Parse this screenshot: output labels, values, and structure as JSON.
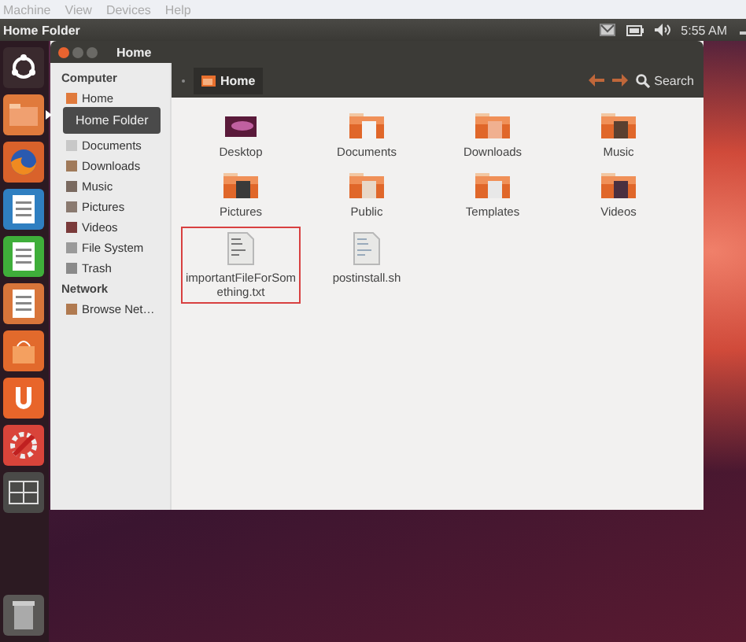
{
  "menubar": [
    {
      "label": "Machine"
    },
    {
      "label": "View"
    },
    {
      "label": "Devices"
    },
    {
      "label": "Help"
    }
  ],
  "top_panel": {
    "title": "Home Folder",
    "clock": "5:55 AM"
  },
  "launcher": {
    "items": [
      {
        "kind": "ubuntu",
        "running": false
      },
      {
        "kind": "home",
        "running": true,
        "tooltip": "Home Folder"
      },
      {
        "kind": "firefox",
        "running": false
      },
      {
        "kind": "writer",
        "running": false
      },
      {
        "kind": "calc",
        "running": false
      },
      {
        "kind": "impress",
        "running": false
      },
      {
        "kind": "software",
        "running": false
      },
      {
        "kind": "ubuntuone",
        "running": false
      },
      {
        "kind": "settings",
        "running": false
      },
      {
        "kind": "workspaces",
        "running": false
      },
      {
        "kind": "trash",
        "running": false
      }
    ]
  },
  "window": {
    "title": "Home",
    "location": "Home",
    "search": "Search",
    "sidebar": [
      {
        "heading": "Computer",
        "items": [
          {
            "label": "Home",
            "kind": "home"
          },
          {
            "label": "Documents",
            "kind": "documents"
          },
          {
            "label": "Downloads",
            "kind": "downloads"
          },
          {
            "label": "Music",
            "kind": "music"
          },
          {
            "label": "Pictures",
            "kind": "pictures"
          },
          {
            "label": "Videos",
            "kind": "videos"
          },
          {
            "label": "File System",
            "kind": "drive"
          },
          {
            "label": "Trash",
            "kind": "trash"
          }
        ]
      },
      {
        "heading": "Network",
        "items": [
          {
            "label": "Browse Net…",
            "kind": "network"
          }
        ]
      }
    ],
    "files": [
      {
        "name": "Desktop",
        "kind": "desktop",
        "selected": false
      },
      {
        "name": "Documents",
        "kind": "documents",
        "selected": false
      },
      {
        "name": "Downloads",
        "kind": "downloads",
        "selected": false
      },
      {
        "name": "Music",
        "kind": "music",
        "selected": false
      },
      {
        "name": "Pictures",
        "kind": "pictures",
        "selected": false
      },
      {
        "name": "Public",
        "kind": "public",
        "selected": false
      },
      {
        "name": "Templates",
        "kind": "templates",
        "selected": false
      },
      {
        "name": "Videos",
        "kind": "videos",
        "selected": false
      },
      {
        "name": "importantFileForSomething.txt",
        "kind": "text",
        "selected": true
      },
      {
        "name": "postinstall.sh",
        "kind": "script",
        "selected": false
      }
    ]
  }
}
